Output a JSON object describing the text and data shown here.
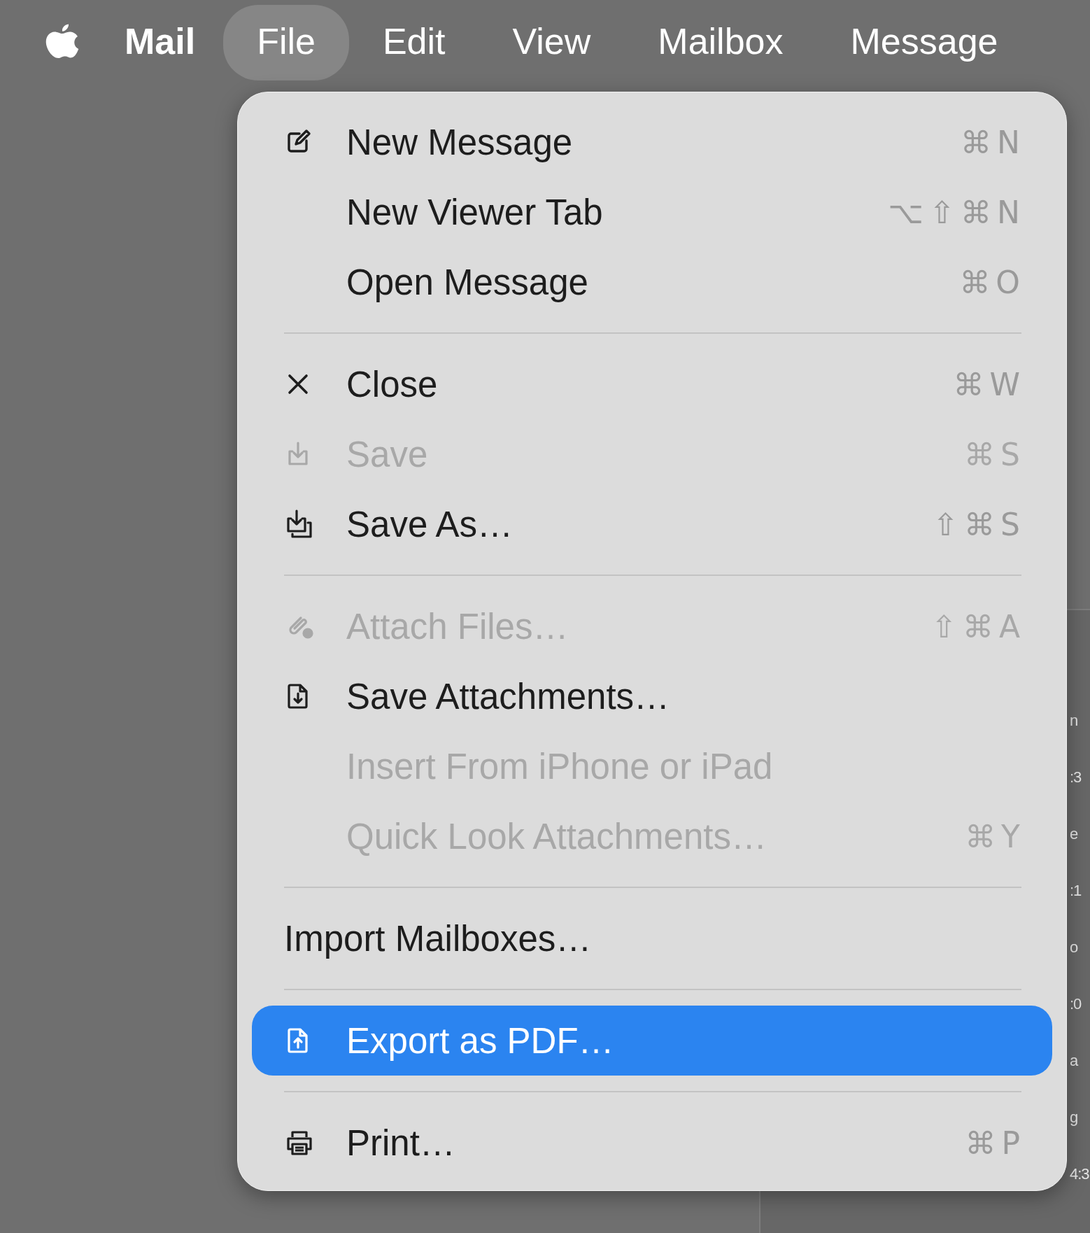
{
  "menu_bar": {
    "items": [
      {
        "label": "Mail",
        "kind": "app",
        "selected": false
      },
      {
        "label": "File",
        "kind": "menu",
        "selected": true
      },
      {
        "label": "Edit",
        "kind": "menu",
        "selected": false
      },
      {
        "label": "View",
        "kind": "menu",
        "selected": false
      },
      {
        "label": "Mailbox",
        "kind": "menu",
        "selected": false
      },
      {
        "label": "Message",
        "kind": "menu",
        "selected": false
      }
    ]
  },
  "file_menu": {
    "items": [
      {
        "kind": "item",
        "label": "New Message",
        "shortcut": "⌘ N",
        "disabled": false,
        "selected": false
      },
      {
        "kind": "item",
        "label": "New Viewer Tab",
        "shortcut": "⌥ ⇧ ⌘ N",
        "disabled": false,
        "selected": false
      },
      {
        "kind": "item",
        "label": "Open Message",
        "shortcut": "⌘ O",
        "disabled": false,
        "selected": false
      },
      {
        "kind": "separator"
      },
      {
        "kind": "item",
        "label": "Close",
        "shortcut": "⌘ W",
        "disabled": false,
        "selected": false
      },
      {
        "kind": "item",
        "label": "Save",
        "shortcut": "⌘ S",
        "disabled": true,
        "selected": false
      },
      {
        "kind": "item",
        "label": "Save As…",
        "shortcut": "⇧ ⌘ S",
        "disabled": false,
        "selected": false
      },
      {
        "kind": "separator"
      },
      {
        "kind": "item",
        "label": "Attach Files…",
        "shortcut": "⇧ ⌘ A",
        "disabled": true,
        "selected": false
      },
      {
        "kind": "item",
        "label": "Save Attachments…",
        "disabled": false,
        "selected": false
      },
      {
        "kind": "item",
        "label": "Insert From iPhone or iPad",
        "disabled": true,
        "selected": false
      },
      {
        "kind": "item",
        "label": "Quick Look Attachments…",
        "shortcut": "⌘ Y",
        "disabled": true,
        "selected": false
      },
      {
        "kind": "separator"
      },
      {
        "kind": "plain",
        "label": "Import Mailboxes…",
        "disabled": false,
        "selected": false
      },
      {
        "kind": "separator"
      },
      {
        "kind": "item",
        "label": "Export as PDF…",
        "disabled": false,
        "selected": true
      },
      {
        "kind": "separator"
      },
      {
        "kind": "item",
        "label": "Print…",
        "shortcut": "⌘ P",
        "disabled": false,
        "selected": false
      }
    ]
  },
  "background_window": {
    "text_fragments": [
      "n",
      ":3",
      "e",
      ":1",
      "o",
      ":0",
      "a",
      "g",
      "4:3"
    ]
  }
}
